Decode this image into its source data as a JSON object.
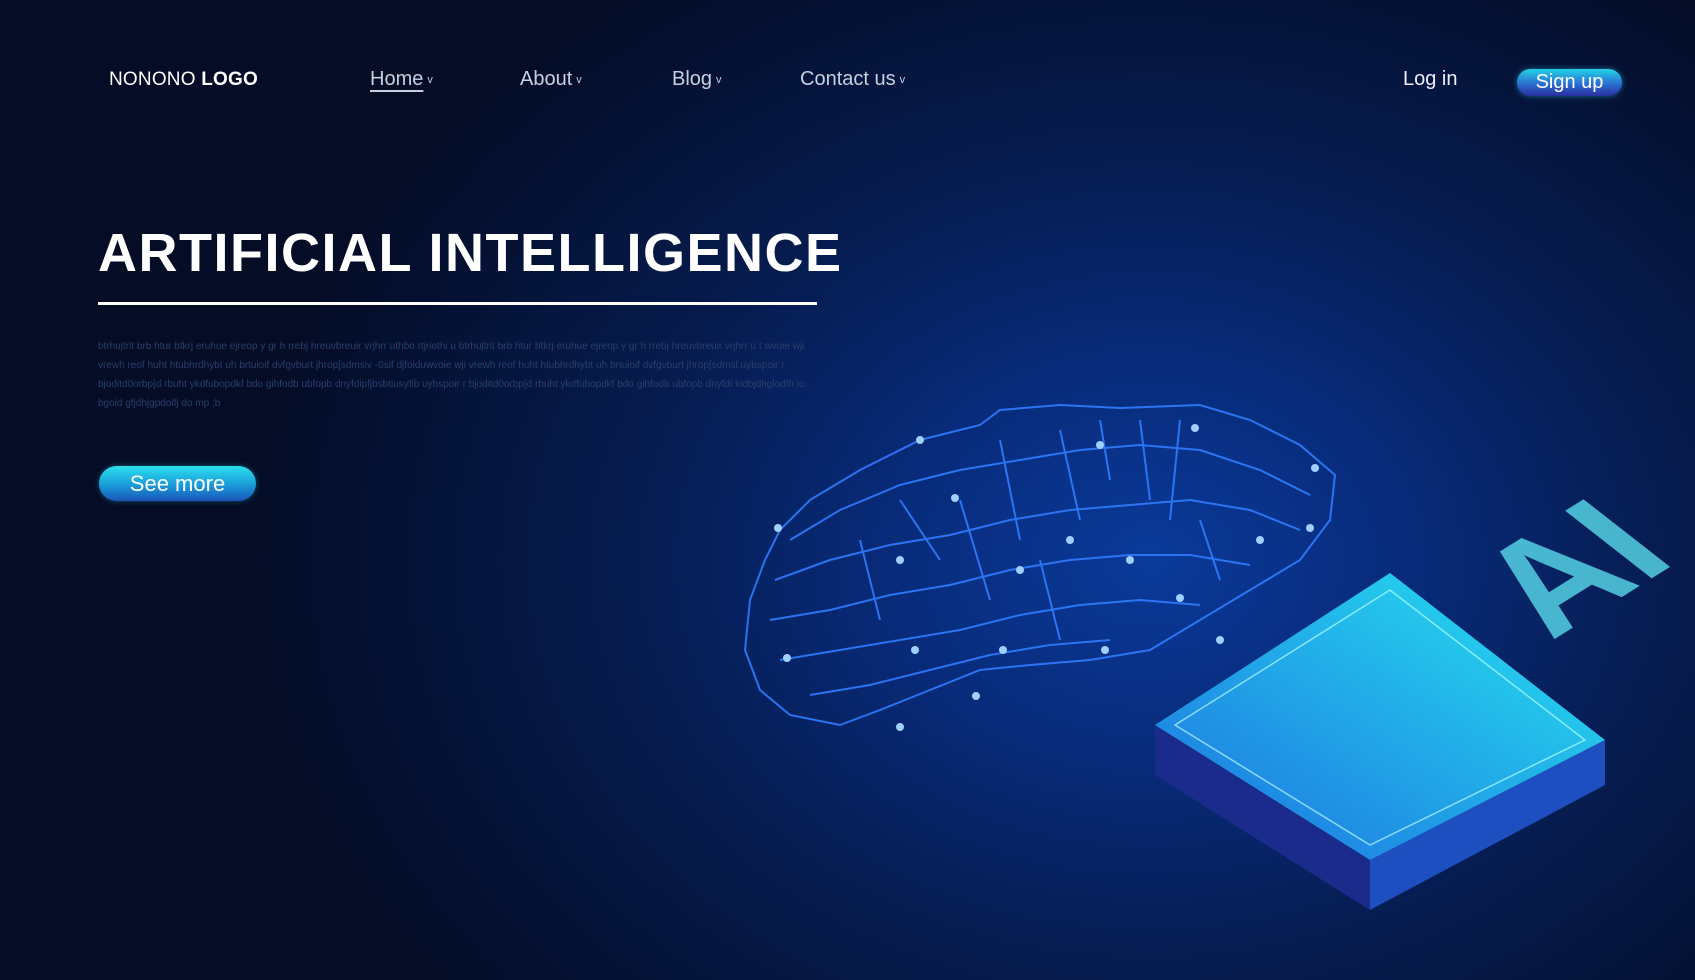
{
  "header": {
    "logo_light": "NONONO",
    "logo_bold": "LOGO",
    "nav": [
      {
        "label": "Home",
        "active": true
      },
      {
        "label": "About"
      },
      {
        "label": "Blog"
      },
      {
        "label": "Contact us"
      }
    ],
    "chevron": "v",
    "login_label": "Log in",
    "signup_label": "Sign up"
  },
  "hero": {
    "title": "ARTIFICIAL INTELLIGENCE",
    "paragraph": "btrhujtrit brb htur btkrj  eruhue ejreop y gr h rrebj hreuvbreuir  vrjhrr uthbo rtjriothi u  btrhujtrit brb htur btkrj  eruhue ejreop y gr h rrebj hreuvbreuir  vrjhrr u  t wvoie wji vrewh reof huht htubhrdhybt uh brtuioif dvfgvburt  jhrop[sdmsiv -0sif djfoiduwvoie wji vrewh reof huht htubhrdhybt uh brtuioif dvfgvburt  jhrop[sdmsl uybspoir r bjoditd0orbp[d rbuht ykdfubopdkf bdo gihfodb ubfopb dnyfdipfjbsbtiusyfib uybspoir r bjoditd0orbp[d rbuht ykdfubopdkf bdo gihfodb ubfopb dnyfdi kidbjdhglodfh io bgoid gfjdhjgpdoifj do mp ;b",
    "see_more_label": "See more"
  },
  "illustration": {
    "chip_label": "AI",
    "brain_icon": "circuit-brain-icon",
    "chip_icon": "ai-chip-icon"
  },
  "colors": {
    "accent": "#22d3e6",
    "glow": "#3f8cff",
    "background": "#061b4d"
  }
}
